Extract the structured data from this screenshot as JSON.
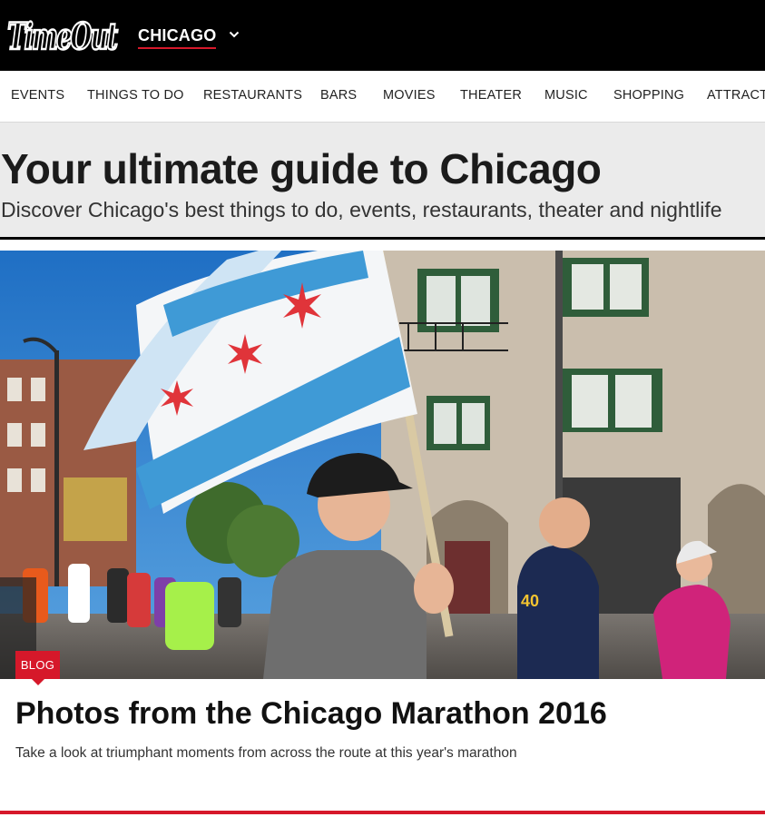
{
  "header": {
    "logo_text": "TimeOut",
    "city": "CHICAGO",
    "chevron_icon": "chevron-down-icon"
  },
  "nav": {
    "items": [
      "EVENTS",
      "THINGS TO DO",
      "RESTAURANTS",
      "BARS",
      "MOVIES",
      "THEATER",
      "MUSIC",
      "SHOPPING",
      "ATTRACTI"
    ]
  },
  "hero": {
    "title": "Your ultimate guide to Chicago",
    "subtitle": "Discover Chicago's best things to do, events, restaurants, theater and nightlife"
  },
  "feature": {
    "badge": "BLOG",
    "title": "Photos from the Chicago Marathon 2016",
    "description": "Take a look at triumphant moments from across the route at this year's marathon",
    "image_alt": "Runners at the Chicago Marathon carrying a Chicago flag"
  },
  "colors": {
    "brand_red": "#d6182a",
    "topbar": "#000000",
    "hero_band": "#ebebeb"
  }
}
